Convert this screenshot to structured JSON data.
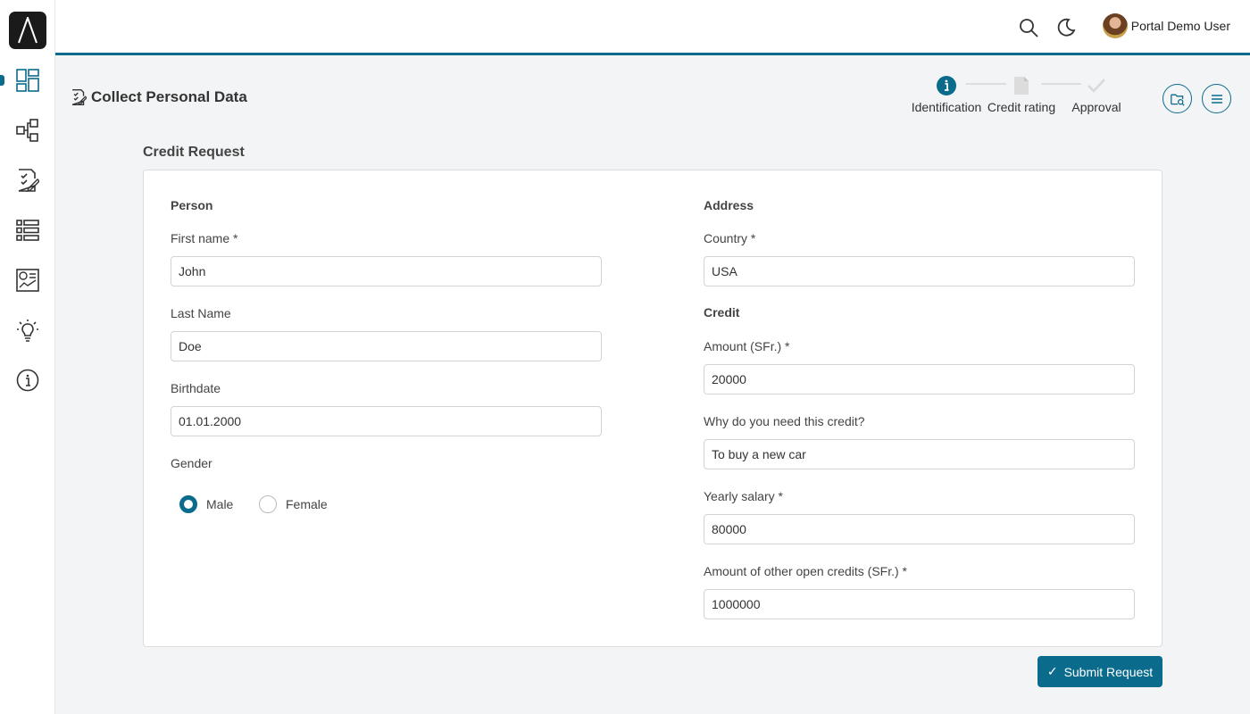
{
  "header": {
    "user_name": "Portal Demo User"
  },
  "page": {
    "title": "Collect Personal Data"
  },
  "stepper": {
    "steps": [
      {
        "label": "Identification",
        "state": "active"
      },
      {
        "label": "Credit rating",
        "state": "pending"
      },
      {
        "label": "Approval",
        "state": "pending"
      }
    ]
  },
  "form": {
    "title": "Credit Request",
    "person": {
      "heading": "Person",
      "first_name_label": "First name *",
      "first_name_value": "John",
      "last_name_label": "Last Name",
      "last_name_value": "Doe",
      "birthdate_label": "Birthdate",
      "birthdate_value": "01.01.2000",
      "gender_label": "Gender",
      "gender_options": [
        "Male",
        "Female"
      ],
      "gender_selected": "Male"
    },
    "address": {
      "heading": "Address",
      "country_label": "Country *",
      "country_value": "USA"
    },
    "credit": {
      "heading": "Credit",
      "amount_label": "Amount (SFr.) *",
      "amount_value": "20000",
      "reason_label": "Why do you need this credit?",
      "reason_value": "To buy a new car",
      "salary_label": "Yearly salary *",
      "salary_value": "80000",
      "other_credits_label": "Amount of other open credits (SFr.) *",
      "other_credits_value": "1000000"
    },
    "submit_label": "Submit Request"
  },
  "colors": {
    "accent": "#0b6b8c"
  },
  "icons": {
    "sidebar": [
      "dashboard-icon",
      "processes-icon",
      "tasks-icon",
      "cases-icon",
      "statistics-icon",
      "processes-ideas-icon",
      "info-icon"
    ],
    "header": [
      "search-icon",
      "moon-icon"
    ]
  }
}
